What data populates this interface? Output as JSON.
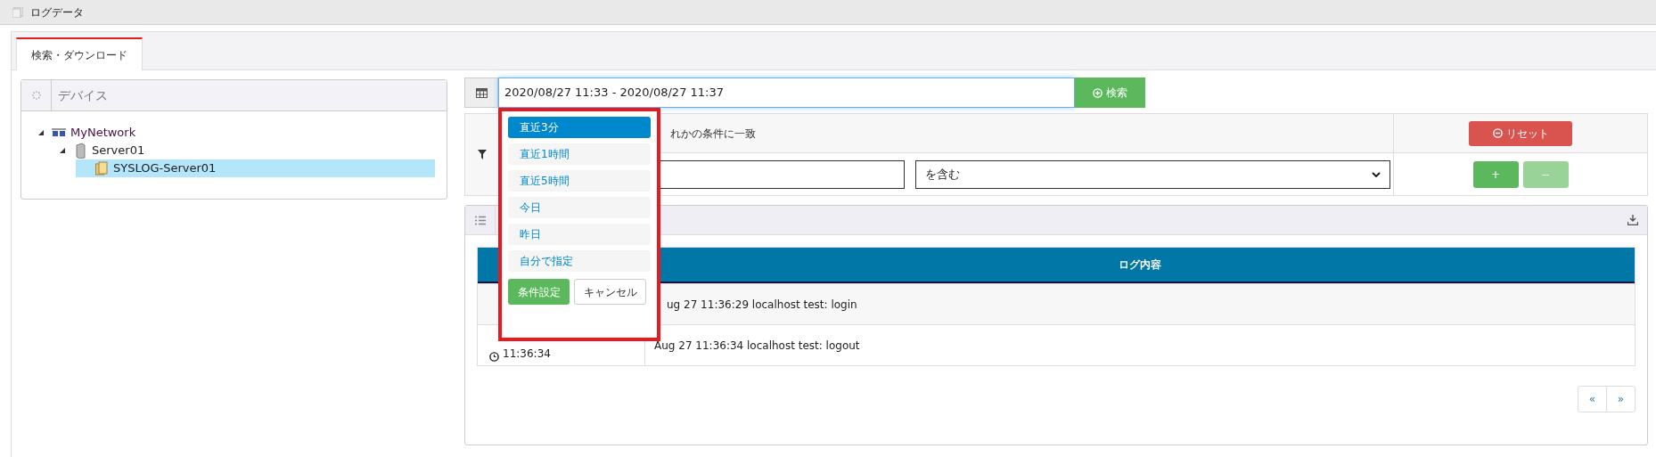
{
  "window": {
    "title": "ログデータ"
  },
  "tabs": [
    {
      "label": "検索・ダウンロード",
      "selected": true
    }
  ],
  "device_panel": {
    "title": "デバイス",
    "tree": [
      {
        "label": "MyNetwork",
        "kind": "network",
        "expanded": true,
        "selected": false,
        "children": [
          {
            "label": "Server01",
            "kind": "server",
            "expanded": true,
            "selected": false,
            "children": [
              {
                "label": "SYSLOG-Server01",
                "kind": "log",
                "selected": false,
                "selected_row": true
              }
            ]
          }
        ]
      }
    ]
  },
  "search": {
    "date_range": "2020/08/27 11:33 - 2020/08/27 11:37",
    "button": "検索"
  },
  "filter": {
    "match_text": "れかの条件に一致",
    "reset_button": "リセット",
    "operator": "を含む",
    "add_button": "+",
    "remove_button": "−",
    "remove_disabled": true
  },
  "log_table": {
    "columns": [
      "ログ内容"
    ],
    "rows": [
      {
        "message": "ug 27 11:36:29 localhost test: login"
      },
      {
        "time": "11:36:34",
        "message": "Aug 27 11:36:34 localhost test: logout"
      }
    ]
  },
  "pagination": [
    "«",
    "»"
  ],
  "date_presets": {
    "items": [
      {
        "label": "直近3分",
        "selected": true
      },
      {
        "label": "直近1時間",
        "selected": false
      },
      {
        "label": "直近5時間",
        "selected": false
      },
      {
        "label": "今日",
        "selected": false
      },
      {
        "label": "昨日",
        "selected": false
      },
      {
        "label": "自分で指定",
        "selected": false
      }
    ],
    "apply_button": "条件設定",
    "cancel_button": "キャンセル"
  }
}
